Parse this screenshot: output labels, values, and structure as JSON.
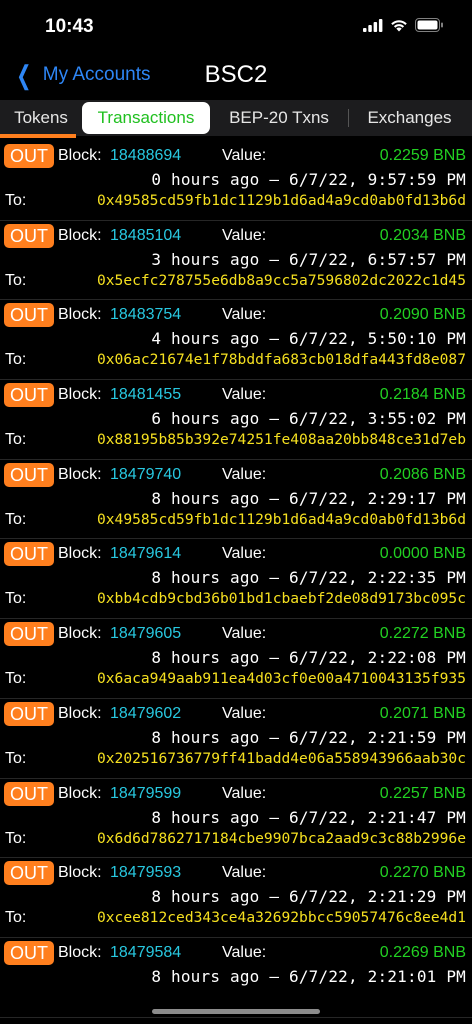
{
  "status_bar": {
    "time": "10:43",
    "icons": [
      "signal-icon",
      "wifi-icon",
      "battery-icon"
    ]
  },
  "nav": {
    "back_label": "My Accounts",
    "title": "BSC2"
  },
  "tabs": [
    {
      "label": "Tokens",
      "active": false
    },
    {
      "label": "Transactions",
      "active": true
    },
    {
      "label": "BEP-20 Txns",
      "active": false
    },
    {
      "label": "Exchanges",
      "active": false
    }
  ],
  "labels": {
    "out": "OUT",
    "block": "Block:",
    "value": "Value:",
    "to": "To:"
  },
  "colors": {
    "accent_orange": "#ff7f1e",
    "block_cyan": "#28c8e0",
    "value_green": "#22d022",
    "address_yellow": "#f5e020",
    "link_blue": "#2e86f5"
  },
  "transactions": [
    {
      "block": "18488694",
      "value": "0.2259 BNB",
      "time": "0 hours ago – 6/7/22, 9:57:59 PM",
      "to": "0x49585cd59fb1dc1129b1d6ad4a9cd0ab0fd13b6d"
    },
    {
      "block": "18485104",
      "value": "0.2034 BNB",
      "time": "3 hours ago – 6/7/22, 6:57:57 PM",
      "to": "0x5ecfc278755e6db8a9cc5a7596802dc2022c1d45"
    },
    {
      "block": "18483754",
      "value": "0.2090 BNB",
      "time": "4 hours ago – 6/7/22, 5:50:10 PM",
      "to": "0x06ac21674e1f78bddfa683cb018dfa443fd8e087"
    },
    {
      "block": "18481455",
      "value": "0.2184 BNB",
      "time": "6 hours ago – 6/7/22, 3:55:02 PM",
      "to": "0x88195b85b392e74251fe408aa20bb848ce31d7eb"
    },
    {
      "block": "18479740",
      "value": "0.2086 BNB",
      "time": "8 hours ago – 6/7/22, 2:29:17 PM",
      "to": "0x49585cd59fb1dc1129b1d6ad4a9cd0ab0fd13b6d"
    },
    {
      "block": "18479614",
      "value": "0.0000 BNB",
      "time": "8 hours ago – 6/7/22, 2:22:35 PM",
      "to": "0xbb4cdb9cbd36b01bd1cbaebf2de08d9173bc095c"
    },
    {
      "block": "18479605",
      "value": "0.2272 BNB",
      "time": "8 hours ago – 6/7/22, 2:22:08 PM",
      "to": "0x6aca949aab911ea4d03cf0e00a4710043135f935"
    },
    {
      "block": "18479602",
      "value": "0.2071 BNB",
      "time": "8 hours ago – 6/7/22, 2:21:59 PM",
      "to": "0x202516736779ff41badd4e06a558943966aab30c"
    },
    {
      "block": "18479599",
      "value": "0.2257 BNB",
      "time": "8 hours ago – 6/7/22, 2:21:47 PM",
      "to": "0x6d6d7862717184cbe9907bca2aad9c3c88b2996e"
    },
    {
      "block": "18479593",
      "value": "0.2270 BNB",
      "time": "8 hours ago – 6/7/22, 2:21:29 PM",
      "to": "0xcee812ced343ce4a32692bbcc59057476c8ee4d1"
    },
    {
      "block": "18479584",
      "value": "0.2269 BNB",
      "time": "8 hours ago – 6/7/22, 2:21:01 PM",
      "to": ""
    }
  ]
}
